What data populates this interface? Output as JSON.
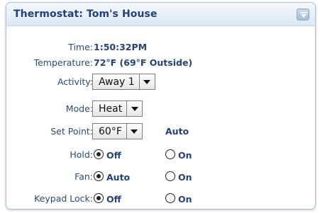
{
  "panel": {
    "title": "Thermostat: Tom's House"
  },
  "status": {
    "time_label": "Time:",
    "time_value": "1:50:32PM",
    "temperature_label": "Temperature:",
    "temperature_value": "72°F (69°F Outside)"
  },
  "activity": {
    "label": "Activity:",
    "value": "Away 1"
  },
  "mode": {
    "label": "Mode:",
    "value": "Heat"
  },
  "set_point": {
    "label": "Set Point:",
    "value": "60°F",
    "auto_text": "Auto"
  },
  "hold": {
    "label": "Hold:",
    "options": [
      {
        "label": "Off",
        "checked": true
      },
      {
        "label": "On",
        "checked": false
      }
    ]
  },
  "fan": {
    "label": "Fan:",
    "options": [
      {
        "label": "Auto",
        "checked": true
      },
      {
        "label": "On",
        "checked": false
      }
    ]
  },
  "keypad_lock": {
    "label": "Keypad Lock:",
    "options": [
      {
        "label": "Off",
        "checked": true
      },
      {
        "label": "On",
        "checked": false
      }
    ]
  },
  "colors": {
    "label_text": "#2b4a7a",
    "value_text": "#23417a",
    "header_gradient_top": "#f4f8fc",
    "header_gradient_bottom": "#dde8f4",
    "panel_border": "#a9c3de"
  },
  "icons": {
    "collapse": "chevron-down-icon",
    "dropdown": "triangle-down-icon"
  }
}
